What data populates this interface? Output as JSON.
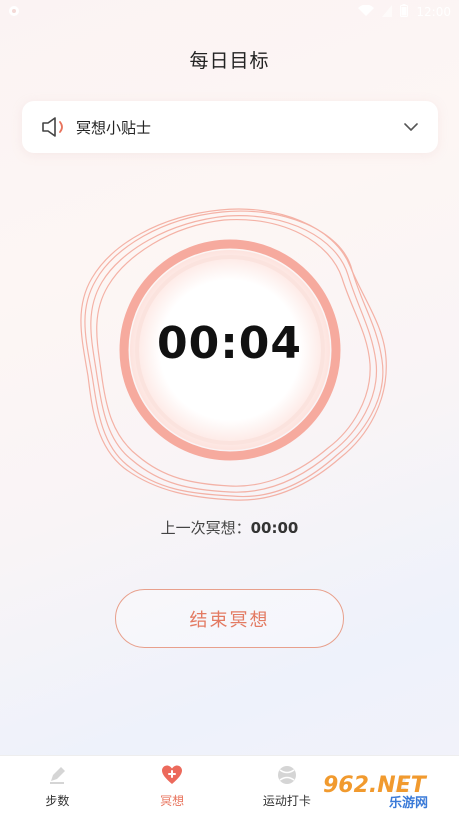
{
  "status_bar": {
    "time": "12:00"
  },
  "header": {
    "title": "每日目标"
  },
  "tips": {
    "label": "冥想小贴士"
  },
  "timer": {
    "value": "00:04"
  },
  "last_session": {
    "label": "上一次冥想：",
    "value": "00:00"
  },
  "end_button": {
    "label": "结束冥想"
  },
  "tabbar": {
    "items": [
      {
        "label": "步数",
        "icon": "pen-icon",
        "active": false
      },
      {
        "label": "冥想",
        "icon": "heart-plus-icon",
        "active": true
      },
      {
        "label": "运动打卡",
        "icon": "ball-icon",
        "active": false
      },
      {
        "label": "",
        "icon": "profile-icon",
        "active": false
      }
    ]
  },
  "watermark": {
    "text": "962.NET",
    "subtext": "乐游网"
  },
  "colors": {
    "accent": "#e8735c",
    "ring": "#f5a59a",
    "button_border": "#e8a08c"
  }
}
